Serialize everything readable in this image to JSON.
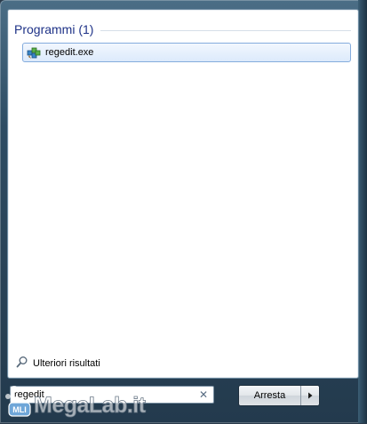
{
  "results": {
    "group_title": "Programmi (1)",
    "items": [
      {
        "label": "regedit.exe",
        "icon": "regedit-icon"
      }
    ]
  },
  "more_results": {
    "label": "Ulteriori risultati",
    "icon": "search-icon"
  },
  "search": {
    "value": "regedit",
    "clear_icon": "close-icon"
  },
  "shutdown": {
    "label": "Arresta",
    "arrow_icon": "arrow-right-icon"
  },
  "watermark": {
    "brand": "MegaLab.it",
    "badge": "MLI"
  },
  "colors": {
    "group_title": "#1e3287",
    "selection_border": "#84acdd",
    "selection_fill": "#dceafb",
    "frame": "#2d4c63"
  }
}
